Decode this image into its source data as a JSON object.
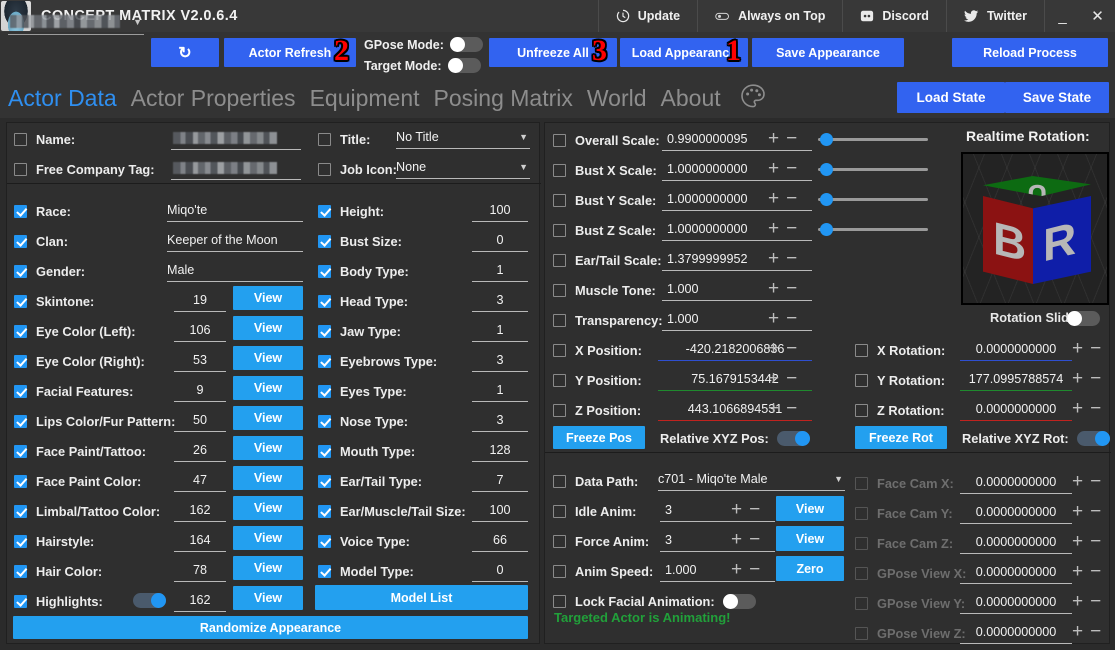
{
  "window": {
    "title": "CONCEPT MATRIX V2.0.6.4",
    "logo_icon": "ffxiv-moogle-logo-icon",
    "menu": [
      {
        "label": "Update",
        "icon": "refresh-clock-icon"
      },
      {
        "label": "Always on Top",
        "icon": "pin-toggle-icon"
      },
      {
        "label": "Discord",
        "icon": "discord-icon"
      },
      {
        "label": "Twitter",
        "icon": "twitter-bird-icon"
      }
    ],
    "minimize": "_",
    "close": "✕"
  },
  "toolbar": {
    "actor_select_value": "",
    "refresh_icon_label": "↻",
    "actor_refresh": "Actor Refresh",
    "unfreeze_all": "Unfreeze All",
    "load_appearance": "Load Appearance",
    "save_appearance": "Save Appearance",
    "reload_process": "Reload Process",
    "gpose_mode_label": "GPose Mode:",
    "gpose_mode_on": false,
    "target_mode_label": "Target Mode:",
    "target_mode_on": false,
    "annotations": [
      {
        "text": "1",
        "target": "load-appearance"
      },
      {
        "text": "2",
        "target": "actor-refresh"
      },
      {
        "text": "3",
        "target": "unfreeze-all"
      }
    ]
  },
  "tabs": {
    "items": [
      "Actor Data",
      "Actor Properties",
      "Equipment",
      "Posing Matrix",
      "World",
      "About"
    ],
    "active": "Actor Data",
    "palette_icon": "palette-icon",
    "load_state": "Load State",
    "save_state": "Save State"
  },
  "appearance": {
    "identity": [
      {
        "label": "Name:",
        "checked": false,
        "value": "",
        "blurred": true
      },
      {
        "label": "Free Company Tag:",
        "checked": false,
        "value": "",
        "blurred": true
      }
    ],
    "identity_right": [
      {
        "label": "Title:",
        "checked": false,
        "value": "No Title",
        "dropdown": true
      },
      {
        "label": "Job Icon:",
        "checked": false,
        "value": "None",
        "dropdown": true
      }
    ],
    "left_column": [
      {
        "label": "Race:",
        "checked": true,
        "value": "Miqo'te",
        "type": "text"
      },
      {
        "label": "Clan:",
        "checked": true,
        "value": "Keeper of the Moon",
        "type": "text"
      },
      {
        "label": "Gender:",
        "checked": true,
        "value": "Male",
        "type": "text"
      },
      {
        "label": "Skintone:",
        "checked": true,
        "value": "19",
        "type": "num",
        "view": "View"
      },
      {
        "label": "Eye Color (Left):",
        "checked": true,
        "value": "106",
        "type": "num",
        "view": "View"
      },
      {
        "label": "Eye Color (Right):",
        "checked": true,
        "value": "53",
        "type": "num",
        "view": "View"
      },
      {
        "label": "Facial Features:",
        "checked": true,
        "value": "9",
        "type": "num",
        "view": "View"
      },
      {
        "label": "Lips Color/Fur Pattern:",
        "checked": true,
        "value": "50",
        "type": "num",
        "view": "View"
      },
      {
        "label": "Face Paint/Tattoo:",
        "checked": true,
        "value": "26",
        "type": "num",
        "view": "View"
      },
      {
        "label": "Face Paint Color:",
        "checked": true,
        "value": "47",
        "type": "num",
        "view": "View"
      },
      {
        "label": "Limbal/Tattoo Color:",
        "checked": true,
        "value": "162",
        "type": "num",
        "view": "View"
      },
      {
        "label": "Hairstyle:",
        "checked": true,
        "value": "164",
        "type": "num",
        "view": "View"
      },
      {
        "label": "Hair Color:",
        "checked": true,
        "value": "78",
        "type": "num",
        "view": "View"
      },
      {
        "label": "Highlights:",
        "checked": true,
        "value": "162",
        "type": "num",
        "view": "View",
        "toggle": true,
        "toggle_on": true
      }
    ],
    "right_column": [
      {
        "label": "Height:",
        "checked": true,
        "value": "100"
      },
      {
        "label": "Bust Size:",
        "checked": true,
        "value": "0"
      },
      {
        "label": "Body Type:",
        "checked": true,
        "value": "1"
      },
      {
        "label": "Head Type:",
        "checked": true,
        "value": "3"
      },
      {
        "label": "Jaw Type:",
        "checked": true,
        "value": "1"
      },
      {
        "label": "Eyebrows Type:",
        "checked": true,
        "value": "3"
      },
      {
        "label": "Eyes Type:",
        "checked": true,
        "value": "1"
      },
      {
        "label": "Nose Type:",
        "checked": true,
        "value": "3"
      },
      {
        "label": "Mouth Type:",
        "checked": true,
        "value": "128"
      },
      {
        "label": "Ear/Tail Type:",
        "checked": true,
        "value": "7"
      },
      {
        "label": "Ear/Muscle/Tail Size:",
        "checked": true,
        "value": "100"
      },
      {
        "label": "Voice Type:",
        "checked": true,
        "value": "66"
      },
      {
        "label": "Model Type:",
        "checked": true,
        "value": "0"
      }
    ],
    "model_list_button": "Model List",
    "randomize_button": "Randomize Appearance"
  },
  "transform": {
    "scales": [
      {
        "label": "Overall Scale:",
        "checked": false,
        "value": "0.9900000095",
        "slider": true,
        "slider_pct": 2
      },
      {
        "label": "Bust X Scale:",
        "checked": false,
        "value": "1.0000000000",
        "slider": true,
        "slider_pct": 2
      },
      {
        "label": "Bust Y Scale:",
        "checked": false,
        "value": "1.0000000000",
        "slider": true,
        "slider_pct": 2
      },
      {
        "label": "Bust Z Scale:",
        "checked": false,
        "value": "1.0000000000",
        "slider": true,
        "slider_pct": 2
      },
      {
        "label": "Ear/Tail Scale:",
        "checked": false,
        "value": "1.3799999952",
        "slider": false
      },
      {
        "label": "Muscle Tone:",
        "checked": false,
        "value": "1.000",
        "slider": false
      },
      {
        "label": "Transparency:",
        "checked": false,
        "value": "1.000",
        "slider": false
      }
    ],
    "positions": [
      {
        "label": "X Position:",
        "checked": false,
        "value": "-420.2182006836",
        "axis": "blue"
      },
      {
        "label": "Y Position:",
        "checked": false,
        "value": "75.1679153442",
        "axis": "green"
      },
      {
        "label": "Z Position:",
        "checked": false,
        "value": "443.1066894531",
        "axis": "red"
      }
    ],
    "freeze_pos": "Freeze Pos",
    "relative_pos_label": "Relative XYZ Pos:",
    "relative_pos_on": true,
    "rotations": [
      {
        "label": "X Rotation:",
        "checked": false,
        "value": "0.0000000000",
        "axis": "blue"
      },
      {
        "label": "Y Rotation:",
        "checked": false,
        "value": "177.0995788574",
        "axis": "green"
      },
      {
        "label": "Z Rotation:",
        "checked": false,
        "value": "0.0000000000",
        "axis": "red"
      }
    ],
    "freeze_rot": "Freeze Rot",
    "relative_rot_label": "Relative XYZ Rot:",
    "relative_rot_on": true,
    "rotation_sliders_label": "Rotation Sliders:",
    "rotation_sliders_on": false,
    "realtime_rotation_title": "Realtime Rotation:",
    "cube": {
      "left_face": "B",
      "right_face": "R",
      "top_face": "U"
    }
  },
  "animation": {
    "data_path_label": "Data Path:",
    "data_path_value": "c701 - Miqo'te Male",
    "rows": [
      {
        "label": "Idle Anim:",
        "checked": false,
        "value": "3",
        "button": "View"
      },
      {
        "label": "Force Anim:",
        "checked": false,
        "value": "3",
        "button": "View"
      },
      {
        "label": "Anim Speed:",
        "checked": false,
        "value": "1.000",
        "button": "Zero"
      }
    ],
    "lock_facial_label": "Lock Facial Animation:",
    "lock_facial_on": false,
    "status": "Targeted Actor is Animating!",
    "status_color": "#21a03a"
  },
  "camera": {
    "rows": [
      {
        "label": "Face Cam X:",
        "checked": false,
        "value": "0.0000000000",
        "disabled": true
      },
      {
        "label": "Face Cam Y:",
        "checked": false,
        "value": "0.0000000000",
        "disabled": true
      },
      {
        "label": "Face Cam Z:",
        "checked": false,
        "value": "0.0000000000",
        "disabled": true
      },
      {
        "label": "GPose View X:",
        "checked": false,
        "value": "0.0000000000",
        "disabled": true
      },
      {
        "label": "GPose View Y:",
        "checked": false,
        "value": "0.0000000000",
        "disabled": true
      },
      {
        "label": "GPose View Z:",
        "checked": false,
        "value": "0.0000000000",
        "disabled": true
      }
    ]
  },
  "colors": {
    "accent_blue": "#3263f0",
    "light_blue": "#23a0ef",
    "tab_active": "#2f8ff0",
    "panel_bg": "#2f2f2f",
    "window_bg": "#2b2b2b",
    "titlebar_bg": "#383838",
    "annotation_red": "#ff0000",
    "status_green": "#21a03a"
  }
}
